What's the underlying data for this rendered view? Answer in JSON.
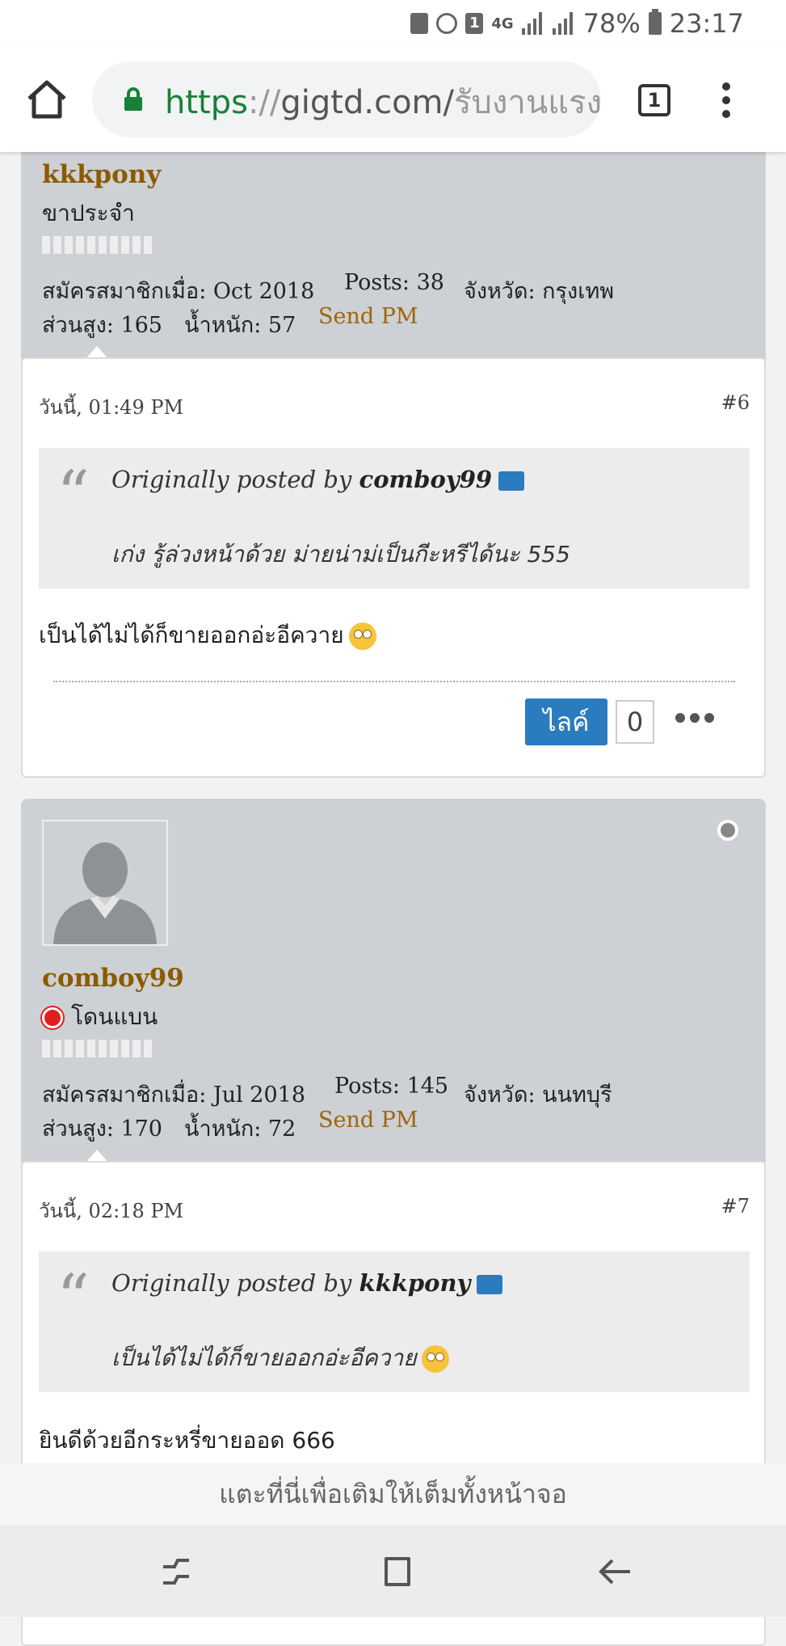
{
  "status_bar": {
    "network": "4G",
    "notification_count": "1",
    "battery": "78%",
    "time": "23:17"
  },
  "browser": {
    "url_scheme": "https",
    "url_sep": "://",
    "url_host": "gigtd.com/",
    "url_path": "รับงานแรง/",
    "tab_count": "1"
  },
  "posts": [
    {
      "author": {
        "name": "kkkpony",
        "title": "ขาประจำ",
        "joined": "สมัครสมาชิกเมื่อ: Oct 2018",
        "posts": "Posts: 38",
        "province": "จังหวัด: กรุงเทพ",
        "height": "ส่วนสูง: 165",
        "weight": "น้ำหนัก: 57",
        "send_pm": "Send PM"
      },
      "date": "วันนี้, 01:49 PM",
      "number": "#6",
      "quote": {
        "prefix": "Originally posted by",
        "quoted_user": "comboy99",
        "text": "เก่ง รู้ล่วงหน้าด้วย ม่ายน่าม่เป็นกีะหรีได้นะ 555"
      },
      "body": "เป็นได้ไม่ได้ก็ขายออกอ่ะอีควาย",
      "like_label": "ไลค์",
      "like_count": "0"
    },
    {
      "author": {
        "name": "comboy99",
        "title": "โดนแบน",
        "joined": "สมัครสมาชิกเมื่อ: Jul 2018",
        "posts": "Posts: 145",
        "province": "จังหวัด: นนทบุรี",
        "height": "ส่วนสูง: 170",
        "weight": "น้ำหนัก: 72",
        "send_pm": "Send PM"
      },
      "date": "วันนี้, 02:18 PM",
      "number": "#7",
      "quote": {
        "prefix": "Originally posted by",
        "quoted_user": "kkkpony",
        "text": "เป็นได้ไม่ได้ก็ขายออกอ่ะอีควาย"
      },
      "body": "ยินดีด้วยอีกระหรี่ขายออด 666"
    }
  ],
  "fullscreen_hint": "แตะที่นี่เพื่อเติมให้เต็มทั้งหน้าจอ"
}
